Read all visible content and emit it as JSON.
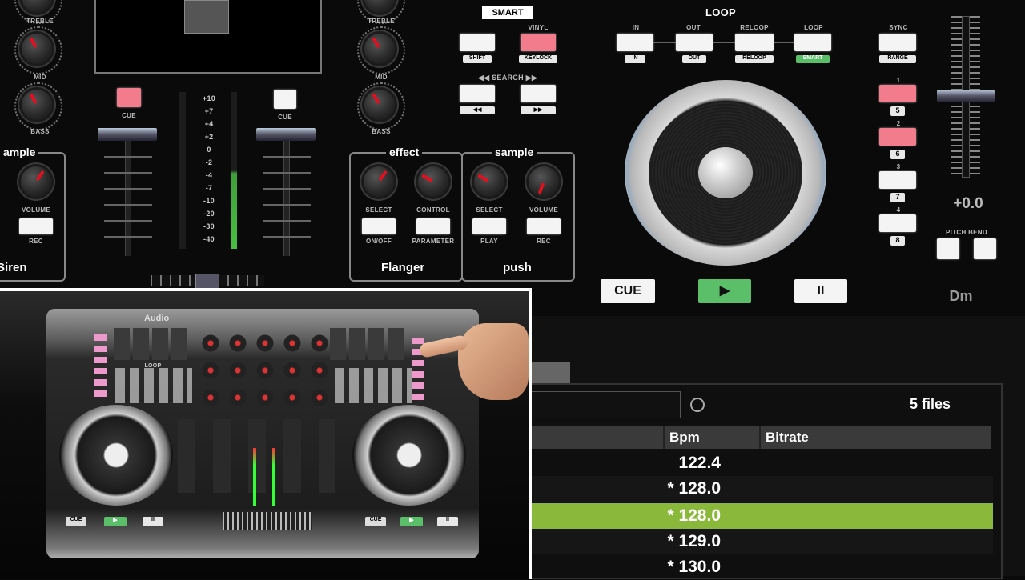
{
  "left_strip": {
    "knob_labels": [
      "TREBLE",
      "MID",
      "BASS"
    ],
    "sample_title": "ample",
    "volume_label": "VOLUME",
    "rec_label": "REC",
    "footer": "Siren"
  },
  "mixer": {
    "cue_left": "CUE",
    "cue_right": "CUE",
    "scale": [
      "+10",
      "+7",
      "+4",
      "+2",
      "0",
      "-2",
      "-4",
      "-7",
      "-10",
      "-20",
      "-30",
      "-40"
    ]
  },
  "right_strip": {
    "knob_labels": [
      "TREBLE",
      "MID",
      "BASS"
    ]
  },
  "effect_panel": {
    "title": "effect",
    "select_label": "SELECT",
    "control_label": "CONTROL",
    "onoff_label": "ON/OFF",
    "param_label": "PARAMETER",
    "footer": "Flanger"
  },
  "sample_panel": {
    "title": "sample",
    "select_label": "SELECT",
    "volume_label": "VOLUME",
    "play_label": "PLAY",
    "rec_label": "REC",
    "footer": "push"
  },
  "smart": {
    "title": "SMART",
    "vinyl_label": "VINYL",
    "shift_label": "SHIFT",
    "keylock_label": "KEYLOCK",
    "search_label": "◀◀ SEARCH ▶▶",
    "search_left": "◀◀",
    "search_right": "▶▶"
  },
  "loop": {
    "title": "LOOP",
    "buttons": [
      {
        "top": "IN",
        "bottom": "IN"
      },
      {
        "top": "OUT",
        "bottom": "OUT"
      },
      {
        "top": "RELOOP",
        "bottom": "RELOOP"
      },
      {
        "top": "LOOP",
        "bottom": "SMART"
      }
    ]
  },
  "sync": {
    "sync_label": "SYNC",
    "range_label": "RANGE",
    "hotcues": [
      "5",
      "6",
      "7",
      "8"
    ],
    "hotcue_nums": [
      "1",
      "2",
      "3",
      "4"
    ]
  },
  "pitch": {
    "value": "+0.0",
    "pitch_bend_label": "PITCH BEND",
    "key": "Dm"
  },
  "transport": {
    "cue": "CUE",
    "play": "▶",
    "pause": "II"
  },
  "browser": {
    "file_count": "5 files",
    "columns": [
      "Bpm",
      "Bitrate"
    ],
    "rows": [
      {
        "bpm": "122.4",
        "selected": false
      },
      {
        "bpm": "* 128.0",
        "selected": false
      },
      {
        "bpm": "* 128.0",
        "selected": true
      },
      {
        "bpm": "* 129.0",
        "selected": false
      },
      {
        "bpm": "* 130.0",
        "selected": false
      }
    ]
  },
  "controller": {
    "brand": "Audio",
    "cue_left": "CUE",
    "cue_right": "CUE",
    "loop_label": "LOOP"
  },
  "colors": {
    "accent_pink": "#f27c8c",
    "accent_green": "#8ab83a",
    "play_green": "#5bbf6a"
  }
}
